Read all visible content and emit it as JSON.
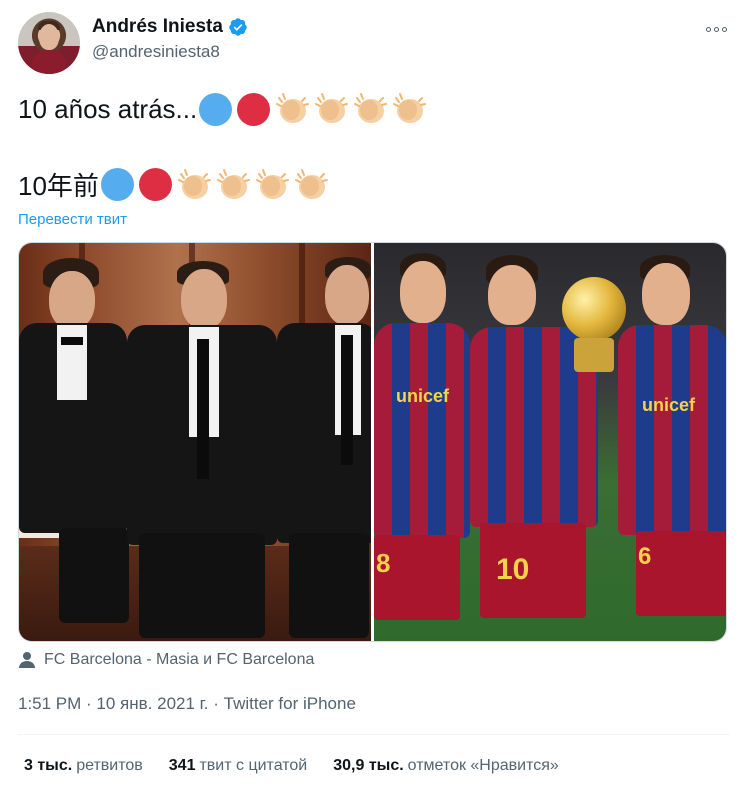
{
  "author": {
    "display_name": "Andrés Iniesta",
    "handle": "@andresiniesta8",
    "verified": true
  },
  "tweet": {
    "line1_text": "10 años atrás...",
    "line2_text": "10年前",
    "emoji_sequence": [
      "blue-circle",
      "red-circle",
      "clapping-hands",
      "clapping-hands",
      "clapping-hands",
      "clapping-hands"
    ],
    "translate_label": "Перевести твит"
  },
  "media": {
    "location": "FC Barcelona - Masia и FC Barcelona",
    "kit_sponsor_left": "unicef",
    "kit_sponsor_right": "unicef",
    "jersey_number_left": "8",
    "jersey_number_center": "10",
    "jersey_number_right": "6"
  },
  "meta": {
    "timestamp": "1:51 PM · 10 янв. 2021 г. · Twitter for iPhone"
  },
  "stats": {
    "retweets_count": "3 тыс.",
    "retweets_label": "ретвитов",
    "quotes_count": "341",
    "quotes_label": "твит с цитатой",
    "likes_count": "30,9 тыс.",
    "likes_label": "отметок «Нравится»"
  },
  "colors": {
    "link": "#1d9bf0",
    "verified": "#1d9bf0",
    "secondary_text": "#536471",
    "primary_text": "#0f1419"
  },
  "icons": [
    "verified-badge-icon",
    "more-icon",
    "person-tag-icon",
    "blue-circle-emoji",
    "red-circle-emoji",
    "clapping-hands-emoji"
  ]
}
